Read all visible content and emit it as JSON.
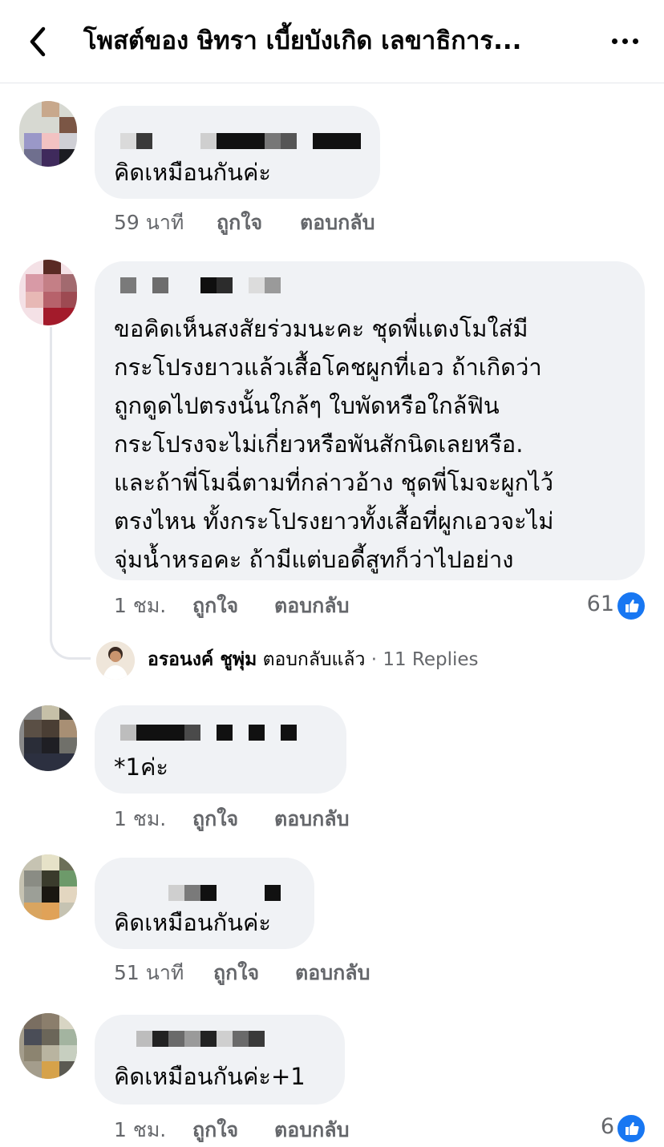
{
  "header": {
    "title": "โพสต์ของ ษิทรา เบี้ยบังเกิด เลขาธิการ...",
    "back_icon": "chevron-left-icon",
    "more_icon": "more-horizontal-icon"
  },
  "actions": {
    "like": "ถูกใจ",
    "reply": "ตอบกลับ"
  },
  "colors": {
    "bubble": "#f0f2f5",
    "meta": "#65676b",
    "like_blue": "#1877f2"
  },
  "comments": [
    {
      "text": "คิดเหมือนกันค่ะ",
      "time": "59 นาที"
    },
    {
      "text": "ขอคิดเห็นสงสัยร่วมนะคะ ชุดพี่แตงโมใส่มี\nกระโปรงยาวแล้วเสื้อโคชผูกที่เอว ถ้าเกิดว่า\nถูกดูดไปตรงนั้นใกล้ๆ ใบพัดหรือใกล้ฟิน\nกระโปรงจะไม่เกี่ยวหรือพันสักนิดเลยหรือ.\nและถ้าพี่โมฉี่ตามที่กล่าวอ้าง ชุดพี่โมจะผูกไว้\nตรงไหน ทั้งกระโปรงยาวทั้งเสื้อที่ผูกเอวจะไม่\nจุ่มน้ำหรอคะ ถ้ามีแต่บอดี้สูทก็ว่าไปอย่าง",
      "time": "1 ชม.",
      "reactions": "61"
    },
    {
      "text": "*1ค่ะ",
      "time": "1 ชม."
    },
    {
      "text": "คิดเหมือนกันค่ะ",
      "time": "51 นาที"
    },
    {
      "text": "คิดเหมือนกันค่ะ+1",
      "time": "1 ชม.",
      "reactions": "6"
    }
  ],
  "reply_preview": {
    "name": "อรอนงค์ ชูพุ่ม",
    "action": "ตอบกลับแล้ว",
    "count": "· 11 Replies"
  }
}
